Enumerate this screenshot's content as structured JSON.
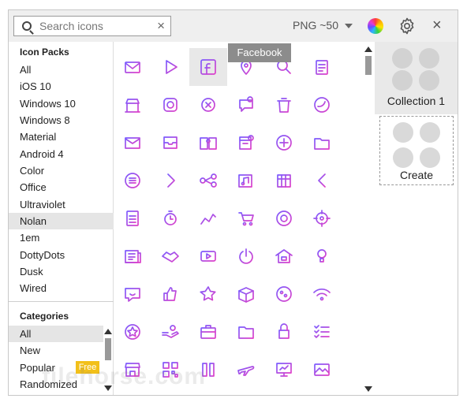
{
  "search": {
    "placeholder": "Search icons",
    "clear_icon": "close-icon"
  },
  "format": {
    "label": "PNG ~50"
  },
  "colors": {
    "accent_start": "#7b5cff",
    "accent_end": "#e040c8",
    "selected_bg": "#e5e5e5",
    "badge": "#f2c01a"
  },
  "icon_packs": {
    "title": "Icon Packs",
    "items": [
      {
        "label": "All"
      },
      {
        "label": "iOS 10"
      },
      {
        "label": "Windows 10"
      },
      {
        "label": "Windows 8"
      },
      {
        "label": "Material"
      },
      {
        "label": "Android 4"
      },
      {
        "label": "Color"
      },
      {
        "label": "Office"
      },
      {
        "label": "Ultraviolet"
      },
      {
        "label": "Nolan"
      },
      {
        "label": "1em"
      },
      {
        "label": "DottyDots"
      },
      {
        "label": "Dusk"
      },
      {
        "label": "Wired"
      }
    ],
    "selected": "Nolan"
  },
  "categories": {
    "title": "Categories",
    "items": [
      {
        "label": "All"
      },
      {
        "label": "New"
      },
      {
        "label": "Popular"
      },
      {
        "label": "Randomized"
      }
    ],
    "selected": "All",
    "free_badge": "Free"
  },
  "tooltip": {
    "text": "Facebook"
  },
  "icons": [
    [
      "mail-at-icon",
      "play-icon",
      "facebook-icon",
      "map-pin-icon",
      "search-doc-icon",
      "clipboard-icon"
    ],
    [
      "store-icon",
      "instagram-icon",
      "cancel-icon",
      "chat-alert-icon",
      "trash-icon",
      "twitter-icon"
    ],
    [
      "mail-icon",
      "inbox-icon",
      "book-icon",
      "calendar-gear-icon",
      "plus-circle-icon",
      "folder-icon"
    ],
    [
      "list-circle-icon",
      "chevron-right-icon",
      "share-icon",
      "music-note-icon",
      "calendar-icon",
      "chevron-left-icon"
    ],
    [
      "document-icon",
      "stopwatch-icon",
      "chart-line-icon",
      "cart-icon",
      "chrome-icon",
      "target-icon"
    ],
    [
      "newspaper-icon",
      "handshake-icon",
      "youtube-icon",
      "power-icon",
      "house-icon",
      "idea-icon"
    ],
    [
      "chat-smile-icon",
      "thumbs-heart-icon",
      "stars-icon",
      "box-icon",
      "cookie-icon",
      "wifi-icon"
    ],
    [
      "star-circle-icon",
      "hand-coin-icon",
      "briefcase-icon",
      "folder-alt-icon",
      "lock-icon",
      "checklist-icon"
    ],
    [
      "shop-icon",
      "qr-icon",
      "pause-icon",
      "airplane-icon",
      "presentation-icon",
      "image-icon"
    ]
  ],
  "collections": {
    "collection_label": "Collection 1",
    "create_label": "Create"
  },
  "watermark": {
    "text": "filehorse.com"
  }
}
